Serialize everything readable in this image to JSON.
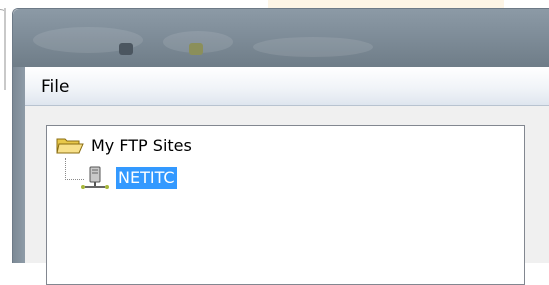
{
  "window": {
    "menu": [
      {
        "label": "File"
      }
    ]
  },
  "tree": {
    "root": {
      "label": "My FTP Sites",
      "icon": "folder-open-icon"
    },
    "children": [
      {
        "label": "NETITC",
        "icon": "ftp-server-icon",
        "selected": true
      }
    ]
  },
  "colors": {
    "selection": "#3399ff",
    "titlebar": "#7f8d99",
    "background_tab": "#fdf5e6"
  }
}
